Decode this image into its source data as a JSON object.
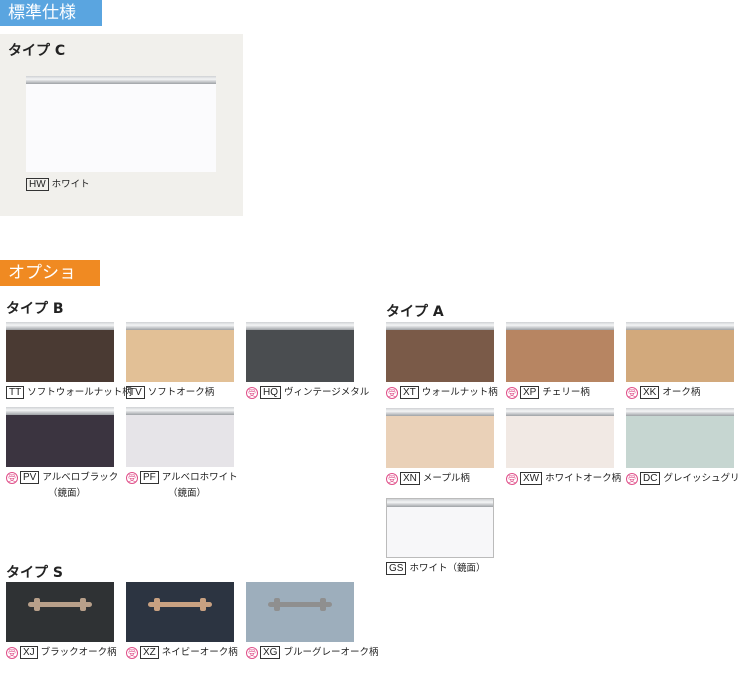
{
  "standard": {
    "tab": "標準仕様",
    "type_label": "タイプ C",
    "item": {
      "code": "HW",
      "name": "ホワイト",
      "color": "#fbfbfd"
    }
  },
  "option": {
    "tab": "オプション"
  },
  "type_b": {
    "label": "タイプ B",
    "items": [
      {
        "recv": "",
        "code": "TT",
        "name": "ソフトウォールナット柄",
        "sub": "",
        "color": "#4a3a33"
      },
      {
        "recv": "",
        "code": "TV",
        "name": "ソフトオーク柄",
        "sub": "",
        "color": "#e2c096"
      },
      {
        "recv": "受",
        "code": "HQ",
        "name": "ヴィンテージメタル",
        "sub": "",
        "color": "#4a4d50"
      },
      {
        "recv": "受",
        "code": "PV",
        "name": "アルベロブラック",
        "sub": "（鏡面）",
        "color": "#3b3440"
      },
      {
        "recv": "受",
        "code": "PF",
        "name": "アルベロホワイト",
        "sub": "（鏡面）",
        "color": "#e6e4e8"
      }
    ]
  },
  "type_a": {
    "label": "タイプ A",
    "items": [
      {
        "recv": "受",
        "code": "XT",
        "name": "ウォールナット柄",
        "sub": "",
        "color": "#7a5a48"
      },
      {
        "recv": "受",
        "code": "XP",
        "name": "チェリー柄",
        "sub": "",
        "color": "#b78562"
      },
      {
        "recv": "受",
        "code": "XK",
        "name": "オーク柄",
        "sub": "",
        "color": "#d2a97c"
      },
      {
        "recv": "受",
        "code": "XN",
        "name": "メープル柄",
        "sub": "",
        "color": "#ead1b8"
      },
      {
        "recv": "受",
        "code": "XW",
        "name": "ホワイトオーク柄",
        "sub": "",
        "color": "#f1e9e4"
      },
      {
        "recv": "受",
        "code": "DC",
        "name": "グレイッシュグリーン",
        "sub": "",
        "color": "#c6d6d1"
      },
      {
        "recv": "",
        "code": "GS",
        "name": "ホワイト（鏡面）",
        "sub": "",
        "color": "#f7f7f9"
      }
    ]
  },
  "type_s": {
    "label": "タイプ S",
    "items": [
      {
        "recv": "受",
        "code": "XJ",
        "name": "ブラックオーク柄",
        "sub": "",
        "color": "#2f3234",
        "handle": "#b8a08a"
      },
      {
        "recv": "受",
        "code": "XZ",
        "name": "ネイビーオーク柄",
        "sub": "",
        "color": "#2c3441",
        "handle": "#c9a181"
      },
      {
        "recv": "受",
        "code": "XG",
        "name": "ブルーグレーオーク柄",
        "sub": "",
        "color": "#9daebc",
        "handle": "#8f8f8f"
      }
    ]
  }
}
